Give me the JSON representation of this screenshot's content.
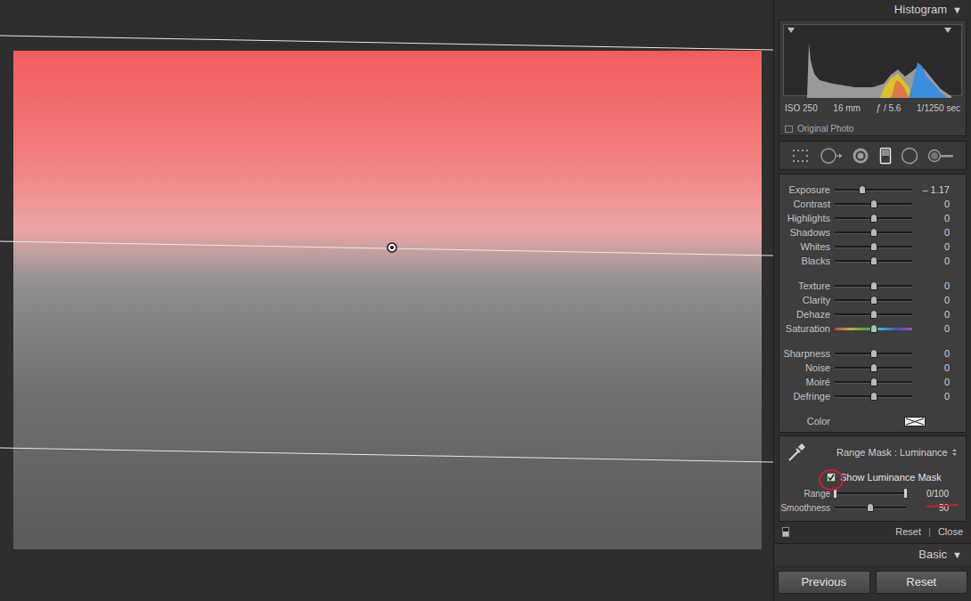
{
  "histogram": {
    "title": "Histogram",
    "toggle": "▼",
    "meta": [
      "ISO 250",
      "16 mm",
      "ƒ / 5.6",
      "1/1250 sec"
    ],
    "original_photo": {
      "label": "Original Photo",
      "checked": false
    }
  },
  "tools": [
    {
      "kind": "crop",
      "selected": false
    },
    {
      "kind": "spot",
      "selected": false
    },
    {
      "kind": "redeye",
      "selected": false
    },
    {
      "kind": "graduated",
      "selected": true
    },
    {
      "kind": "radial",
      "selected": false
    },
    {
      "kind": "brush",
      "selected": false
    }
  ],
  "adjustments": [
    [
      {
        "label": "Exposure",
        "value": "– 1.17",
        "level": 0.354,
        "kind": "plain"
      },
      {
        "label": "Contrast",
        "value": "0",
        "level": 0.5,
        "kind": "plain"
      },
      {
        "label": "Highlights",
        "value": "0",
        "level": 0.5,
        "kind": "plain"
      },
      {
        "label": "Shadows",
        "value": "0",
        "level": 0.5,
        "kind": "plain"
      },
      {
        "label": "Whites",
        "value": "0",
        "level": 0.5,
        "kind": "plain"
      },
      {
        "label": "Blacks",
        "value": "0",
        "level": 0.5,
        "kind": "plain"
      }
    ],
    [
      {
        "label": "Texture",
        "value": "0",
        "level": 0.5,
        "kind": "plain"
      },
      {
        "label": "Clarity",
        "value": "0",
        "level": 0.5,
        "kind": "plain"
      },
      {
        "label": "Dehaze",
        "value": "0",
        "level": 0.5,
        "kind": "plain"
      },
      {
        "label": "Saturation",
        "value": "0",
        "level": 0.5,
        "kind": "spectrum"
      }
    ],
    [
      {
        "label": "Sharpness",
        "value": "0",
        "level": 0.5,
        "kind": "plain"
      },
      {
        "label": "Noise",
        "value": "0",
        "level": 0.5,
        "kind": "plain"
      },
      {
        "label": "Moiré",
        "value": "0",
        "level": 0.5,
        "kind": "plain"
      },
      {
        "label": "Defringe",
        "value": "0",
        "level": 0.5,
        "kind": "plain"
      }
    ]
  ],
  "color_swatch": {
    "label": "Color",
    "empty": true
  },
  "range_mask": {
    "label": "Range Mask : Luminance",
    "show_mask": {
      "label": "Show Luminance Mask",
      "checked": true
    },
    "sliders": [
      {
        "label": "Range",
        "reading": "0/100",
        "kind": "range",
        "low": 0,
        "high": 1
      },
      {
        "label": "Smoothness",
        "reading": "50",
        "kind": "single",
        "level": 0.5
      }
    ]
  },
  "footer": {
    "switch_on": true,
    "reset": "Reset",
    "separator": "|",
    "close": "Close"
  },
  "basic": {
    "title": "Basic",
    "toggle": "▼"
  },
  "buttons": [
    "Previous",
    "Reset"
  ]
}
